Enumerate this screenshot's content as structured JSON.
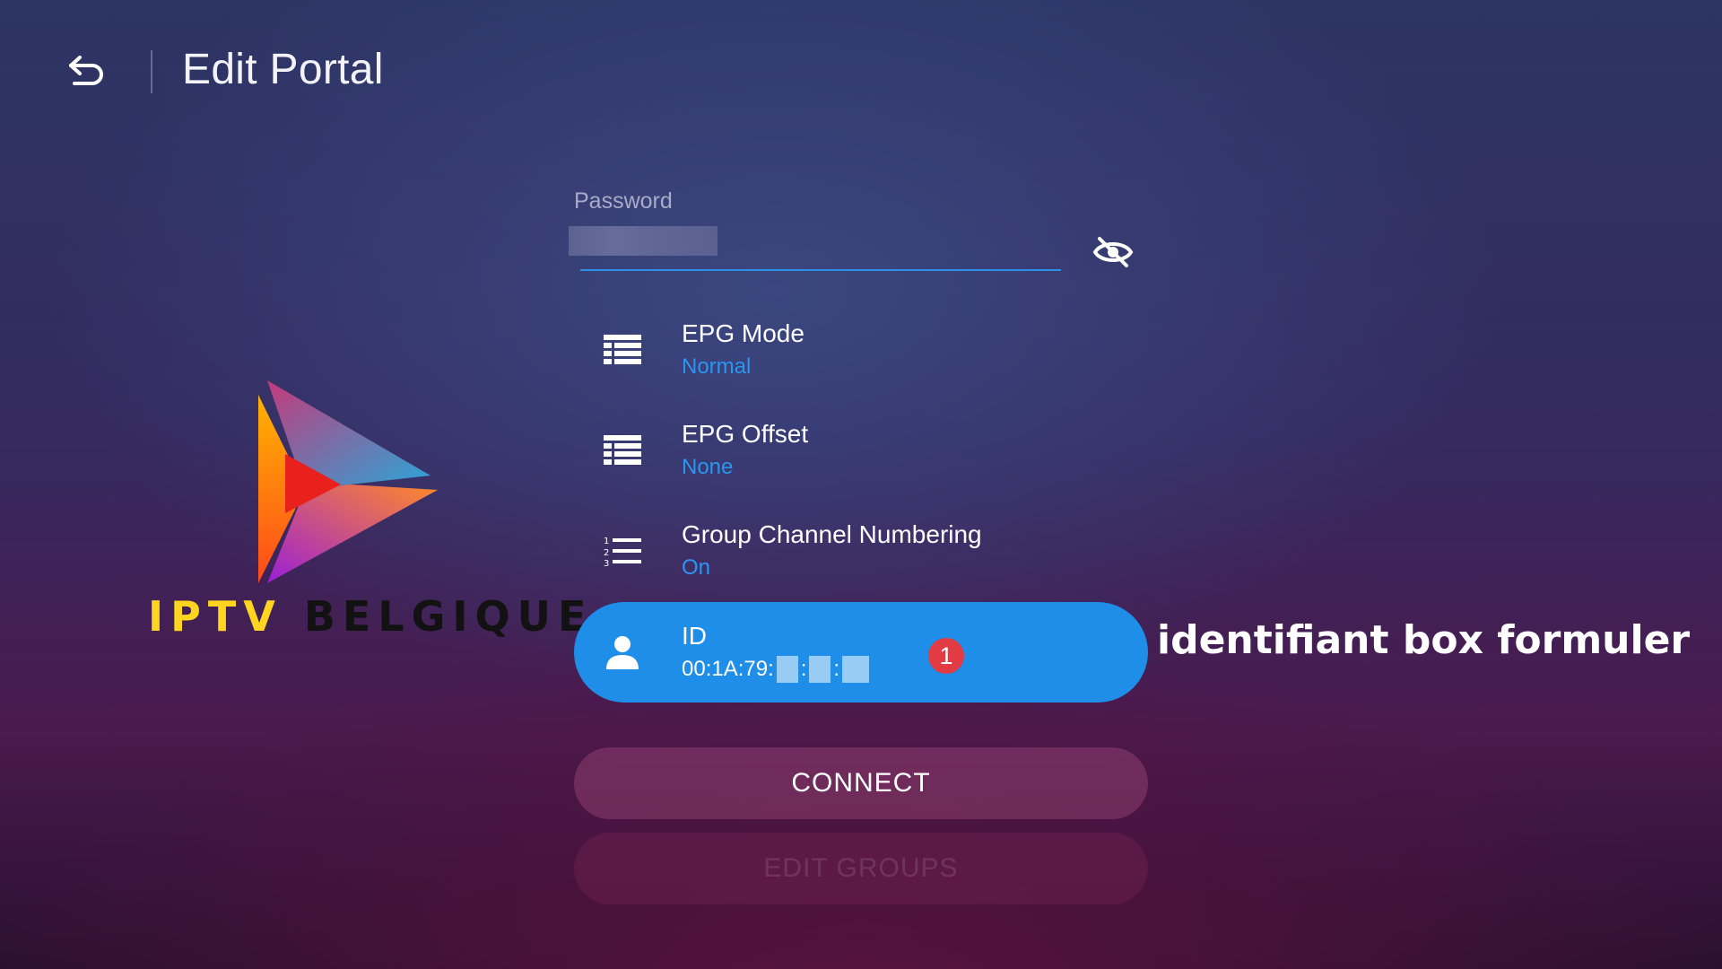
{
  "header": {
    "back_icon": "back-arrow-icon",
    "title": "Edit Portal"
  },
  "logo": {
    "text_part1": "IPTV",
    "text_part2": "BELGIQUE",
    "colors": {
      "iptv": "#ffd51f",
      "belgique": "#121212"
    }
  },
  "password": {
    "label": "Password",
    "value_masked": true,
    "visibility_icon": "eye-off-icon"
  },
  "settings": [
    {
      "icon": "list-grid-icon",
      "title": "EPG Mode",
      "value": "Normal"
    },
    {
      "icon": "list-grid-icon",
      "title": "EPG Offset",
      "value": "None"
    },
    {
      "icon": "numbered-list-icon",
      "title": "Group Channel Numbering",
      "value": "On"
    }
  ],
  "id_row": {
    "icon": "person-icon",
    "title": "ID",
    "value_prefix": "00:1A:79:",
    "separator": ":",
    "badge": "1",
    "selected": true
  },
  "annotation": "identifiant box formuler",
  "buttons": {
    "connect": "CONNECT",
    "edit_groups": "EDIT GROUPS"
  },
  "colors": {
    "accent": "#1e8ee8",
    "value_blue": "#2b96f2",
    "badge_red": "#e33b43"
  }
}
